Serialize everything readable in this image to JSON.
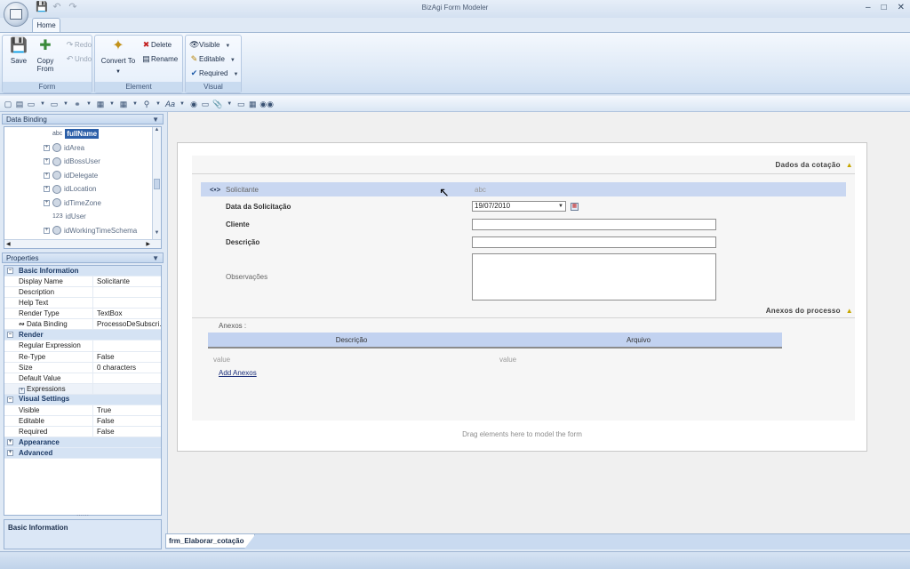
{
  "app": {
    "title": "BizAgi Form Modeler"
  },
  "ribbon": {
    "tab_home": "Home",
    "form_group": {
      "label": "Form",
      "save": "Save",
      "copy_from": "Copy From",
      "redo": "Redo",
      "undo": "Undo"
    },
    "element_group": {
      "label": "Element",
      "convert_to": "Convert To",
      "delete": "Delete",
      "rename": "Rename"
    },
    "visual_group": {
      "label": "Visual",
      "visible": "Visible",
      "editable": "Editable",
      "required": "Required"
    }
  },
  "data_binding": {
    "header": "Data Binding",
    "items": [
      {
        "type": "abc",
        "label": "fullName",
        "selected": true
      },
      {
        "type": "gear",
        "label": "idArea"
      },
      {
        "type": "gear",
        "label": "idBossUser"
      },
      {
        "type": "gear",
        "label": "idDelegate"
      },
      {
        "type": "gear",
        "label": "idLocation"
      },
      {
        "type": "gear",
        "label": "idTimeZone"
      },
      {
        "type": "123",
        "label": "idUser"
      },
      {
        "type": "gear",
        "label": "idWorkingTimeSchema"
      }
    ]
  },
  "properties": {
    "header": "Properties",
    "cat_basic": "Basic Information",
    "display_name": {
      "name": "Display Name",
      "value": "Solicitante"
    },
    "description": {
      "name": "Description",
      "value": ""
    },
    "help_text": {
      "name": "Help Text",
      "value": ""
    },
    "render_type": {
      "name": "Render Type",
      "value": "TextBox"
    },
    "data_binding": {
      "name": "Data Binding",
      "value": "ProcessoDeSubscri..."
    },
    "cat_render": "Render",
    "regular_expression": {
      "name": "Regular Expression",
      "value": ""
    },
    "re_type": {
      "name": "Re-Type",
      "value": "False"
    },
    "size": {
      "name": "Size",
      "value": "0 characters"
    },
    "default_value": {
      "name": "Default Value",
      "value": ""
    },
    "expressions": "Expressions",
    "cat_visual": "Visual Settings",
    "visible": {
      "name": "Visible",
      "value": "True"
    },
    "editable": {
      "name": "Editable",
      "value": "False"
    },
    "required": {
      "name": "Required",
      "value": "False"
    },
    "cat_appearance": "Appearance",
    "cat_advanced": "Advanced",
    "help_title": "Basic Information"
  },
  "form": {
    "section1_title": "Dados da cotação",
    "solicitante_label": "Solicitante",
    "solicitante_placeholder": "abc",
    "data_label": "Data da Solicitação",
    "data_value": "19/07/2010",
    "cliente_label": "Cliente",
    "descricao_label": "Descrição",
    "observacoes_label": "Observações",
    "section2_title": "Anexos do processo",
    "anexos_label": "Anexos :",
    "grid_col1": "Descrição",
    "grid_col2": "Arquivo",
    "grid_val1": "value",
    "grid_val2": "value",
    "add_link": "Add Anexos",
    "drag_hint": "Drag elements here to model the form"
  },
  "doc_tab": "frm_Elaborar_cotação"
}
